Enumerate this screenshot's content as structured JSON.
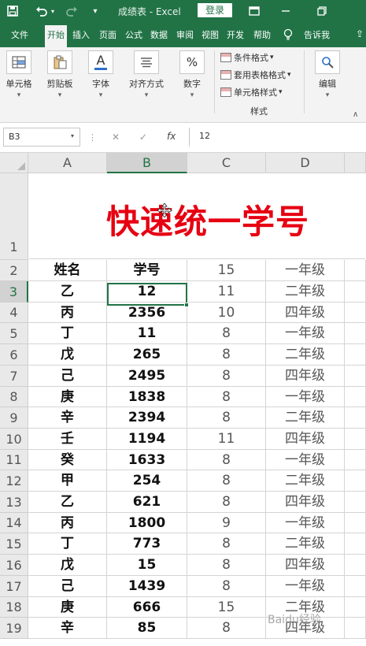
{
  "titlebar": {
    "save_icon": "save-icon",
    "undo_icon": "undo-icon",
    "redo_icon": "redo-icon",
    "customize_icon": "customize-qat-icon",
    "doc_title": "成绩表 - Excel",
    "login_label": "登录",
    "ribbon_display_icon": "ribbon-display-icon",
    "minimize_icon": "minimize-icon",
    "restore_icon": "restore-icon",
    "accent_color": "#217346"
  },
  "tabs": [
    {
      "label": "文件"
    },
    {
      "label": "开始"
    },
    {
      "label": "插入"
    },
    {
      "label": "页面"
    },
    {
      "label": "公式"
    },
    {
      "label": "数据"
    },
    {
      "label": "审阅"
    },
    {
      "label": "视图"
    },
    {
      "label": "开发"
    },
    {
      "label": "帮助"
    },
    {
      "label": "告诉我"
    }
  ],
  "ribbon": {
    "cells_label": "单元格",
    "clipboard_label": "剪贴板",
    "font_label": "字体",
    "font_glyph": "A",
    "alignment_label": "对齐方式",
    "number_label": "数字",
    "number_glyph": "%",
    "cond_format_label": "条件格式",
    "table_format_label": "套用表格格式",
    "cell_styles_label": "单元格样式",
    "styles_group_label": "样式",
    "editing_label": "编辑"
  },
  "formula_bar": {
    "name_box": "B3",
    "cancel_symbol": "✕",
    "enter_symbol": "✓",
    "fx_label": "fx",
    "content": "12"
  },
  "grid": {
    "columns": [
      "A",
      "B",
      "C",
      "D"
    ],
    "selected_column": "B",
    "selected_row": 3,
    "title": "快速统一学号",
    "header_row": {
      "row": 2,
      "a": "姓名",
      "b": "学号",
      "c": "15",
      "d": "一年级"
    },
    "rows": [
      {
        "row": "3",
        "a": "乙",
        "b": "12",
        "c": "11",
        "d": "二年级"
      },
      {
        "row": "4",
        "a": "丙",
        "b": "2356",
        "c": "10",
        "d": "四年级"
      },
      {
        "row": "5",
        "a": "丁",
        "b": "11",
        "c": "8",
        "d": "一年级"
      },
      {
        "row": "6",
        "a": "戊",
        "b": "265",
        "c": "8",
        "d": "二年级"
      },
      {
        "row": "7",
        "a": "己",
        "b": "2495",
        "c": "8",
        "d": "四年级"
      },
      {
        "row": "8",
        "a": "庚",
        "b": "1838",
        "c": "8",
        "d": "一年级"
      },
      {
        "row": "9",
        "a": "辛",
        "b": "2394",
        "c": "8",
        "d": "二年级"
      },
      {
        "row": "10",
        "a": "壬",
        "b": "1194",
        "c": "11",
        "d": "四年级"
      },
      {
        "row": "11",
        "a": "癸",
        "b": "1633",
        "c": "8",
        "d": "一年级"
      },
      {
        "row": "12",
        "a": "甲",
        "b": "254",
        "c": "8",
        "d": "二年级"
      },
      {
        "row": "13",
        "a": "乙",
        "b": "621",
        "c": "8",
        "d": "四年级"
      },
      {
        "row": "14",
        "a": "丙",
        "b": "1800",
        "c": "9",
        "d": "一年级"
      },
      {
        "row": "15",
        "a": "丁",
        "b": "773",
        "c": "8",
        "d": "二年级"
      },
      {
        "row": "16",
        "a": "戊",
        "b": "15",
        "c": "8",
        "d": "四年级"
      },
      {
        "row": "17",
        "a": "己",
        "b": "1439",
        "c": "8",
        "d": "一年级"
      },
      {
        "row": "18",
        "a": "庚",
        "b": "666",
        "c": "15",
        "d": "二年级"
      },
      {
        "row": "19",
        "a": "辛",
        "b": "85",
        "c": "8",
        "d": "四年级"
      }
    ],
    "title_color": "#e60012"
  },
  "watermark": "Baidu经验"
}
